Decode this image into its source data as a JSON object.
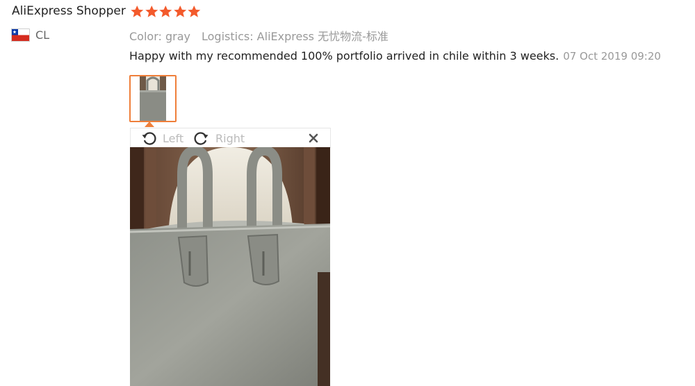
{
  "review": {
    "user_name": "AliExpress Shopper",
    "rating": 5,
    "country_code": "CL",
    "flag_icon": "chile-flag-icon",
    "color_attr": "Color: gray",
    "logistics_attr": "Logistics: AliExpress 无忧物流-标准",
    "text": "Happy with my recommended 100% portfolio arrived in chile within 3 weeks.",
    "date": "07 Oct 2019 09:20"
  },
  "viewer": {
    "rotate_left_label": "Left",
    "rotate_right_label": "Right",
    "rotate_left_icon": "rotate-left-icon",
    "rotate_right_icon": "rotate-right-icon",
    "close_icon": "close-icon"
  },
  "colors": {
    "star": "#f35a2c",
    "thumb_border": "#ef7f3a",
    "muted_text": "#999999",
    "viewer_label": "#bbbbbb"
  }
}
